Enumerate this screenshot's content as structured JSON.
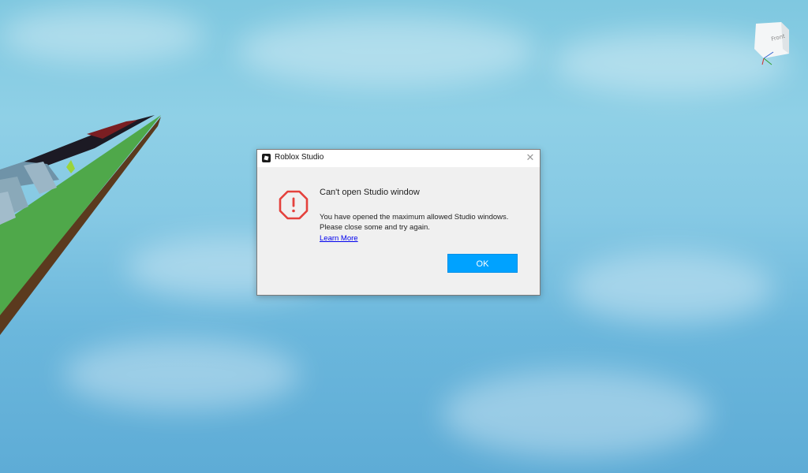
{
  "scene": {
    "view_cube_label": "Front"
  },
  "dialog": {
    "title": "Roblox Studio",
    "heading": "Can't open Studio window",
    "message": "You have opened the maximum allowed Studio windows. Please close some and try again.",
    "link_text": "Learn More",
    "ok_label": "OK",
    "close_icon": "✕",
    "icons": {
      "app": "roblox-logo-icon",
      "warning": "stop-alert-icon",
      "close": "close-icon"
    },
    "colors": {
      "accent": "#00a2ff",
      "warning": "#e4413c",
      "link": "#0000ee"
    }
  }
}
